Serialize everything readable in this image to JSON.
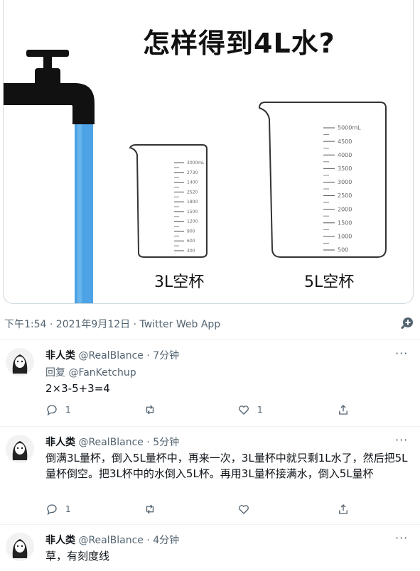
{
  "image": {
    "title": "怎样得到4L水?",
    "cup3_label": "3L空杯",
    "cup5_label": "5L空杯",
    "cup3_ticks": [
      "3000mL",
      "2730",
      "1400",
      "2520",
      "1800",
      "1500",
      "1200",
      "900",
      "600",
      "300"
    ],
    "cup5_ticks": [
      "5000mL",
      "4500",
      "4000",
      "3500",
      "3000",
      "2500",
      "2000",
      "1500",
      "1000",
      "500"
    ],
    "colors": {
      "water": "#4da3e6",
      "faucet": "#111111"
    }
  },
  "tweet": {
    "meta": "下午1:54 · 2021年9月12日 · Twitter Web App",
    "zoom_icon": "zoom-in-icon"
  },
  "replies": [
    {
      "name": "非人类",
      "handle": "@RealBlance · 7分钟",
      "reply_to_prefix": "回复 ",
      "reply_to_mention": "@FanKetchup",
      "text": "2×3-5+3=4",
      "reply_count": "1",
      "retweet_count": "",
      "like_count": "1"
    },
    {
      "name": "非人类",
      "handle": "@RealBlance · 5分钟",
      "text": "倒满3L量杯，倒入5L量杯中，再来一次，3L量杯中就只剩1L水了，然后把5L量杯倒空。把3L杯中的水倒入5L杯。再用3L量杯接满水，倒入5L量杯",
      "reply_count": "1",
      "retweet_count": "",
      "like_count": ""
    },
    {
      "name": "非人类",
      "handle": "@RealBlance · 4分钟",
      "text": "草，有刻度线"
    }
  ],
  "more_label": "···"
}
